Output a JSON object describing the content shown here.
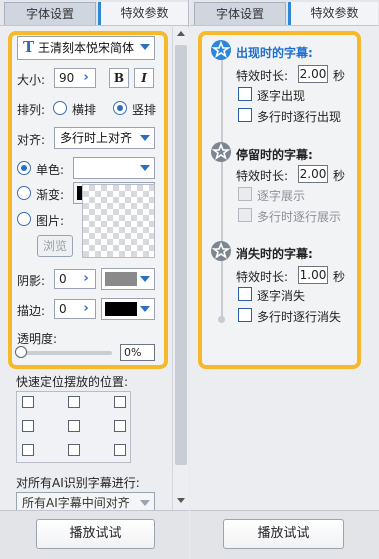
{
  "left_tabs": {
    "active": "字体设置",
    "inactive": "特效参数"
  },
  "right_tabs": {
    "active": "字体设置",
    "inactive": "特效参数"
  },
  "font": {
    "name": "王清刻本悦宋简体",
    "icon": "font-T-icon"
  },
  "size": {
    "label": "大小:",
    "value": "90",
    "bold": "B",
    "italic": "I"
  },
  "layout": {
    "label": "排列:",
    "horizontal": "横排",
    "vertical": "竖排",
    "selected": "竖排"
  },
  "align": {
    "label": "对齐:",
    "value": "多行时上对齐"
  },
  "fill": {
    "solid": "单色:",
    "gradient": "渐变:",
    "image": "图片:",
    "browse": "浏览",
    "selected": "单色",
    "gradient_color": "#111111"
  },
  "shadow": {
    "label": "阴影:",
    "value": "0",
    "color": "#8a8a8a"
  },
  "stroke": {
    "label": "描边:",
    "value": "0",
    "color": "#000000"
  },
  "opacity": {
    "label": "透明度:",
    "value": "0%",
    "level": 0
  },
  "position": {
    "label": "快速定位摆放的位置:"
  },
  "ai": {
    "label": "对所有AI识别字幕进行:",
    "value": "所有AI字幕中间对齐"
  },
  "play_button": "播放试试",
  "effects": {
    "appear": {
      "title": "出现时的字幕:",
      "duration_label": "特效时长:",
      "duration": "2.00",
      "unit": "秒",
      "opt1": "逐字出现",
      "opt2": "多行时逐行出现"
    },
    "stay": {
      "title": "停留时的字幕:",
      "duration_label": "特效时长:",
      "duration": "2.00",
      "unit": "秒",
      "opt1": "逐字展示",
      "opt2": "多行时逐行展示"
    },
    "disappear": {
      "title": "消失时的字幕:",
      "duration_label": "特效时长:",
      "duration": "1.00",
      "unit": "秒",
      "opt1": "逐字消失",
      "opt2": "多行时逐行消失"
    }
  },
  "colors": {
    "accent": "#f7b82a",
    "blue": "#2b6fc1",
    "tab_marker": "#2d86d8"
  }
}
